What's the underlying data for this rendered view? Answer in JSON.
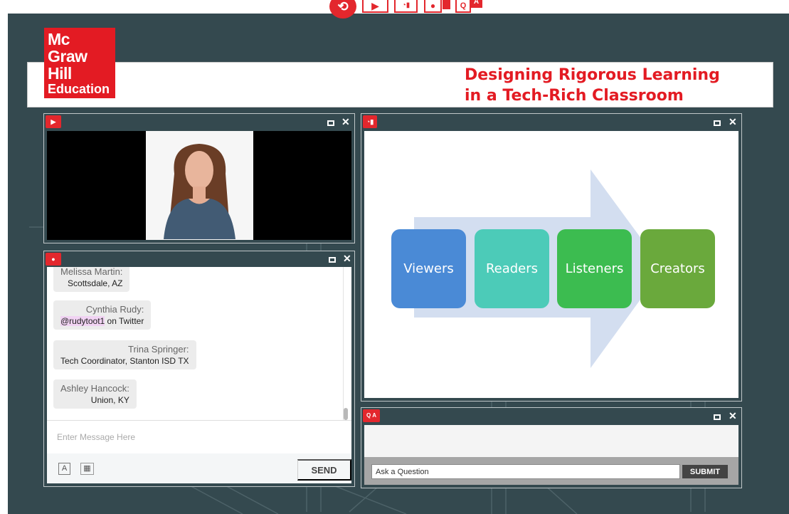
{
  "toolbar": {
    "buttons": [
      {
        "name": "refresh",
        "icon": "refresh-icon",
        "glyph": "⟲"
      },
      {
        "name": "video",
        "icon": "play-icon",
        "glyph": "▶"
      },
      {
        "name": "slides",
        "icon": "slides-chart-icon",
        "glyph": "◔▮"
      },
      {
        "name": "people",
        "icon": "user-chat-icon",
        "glyph": "●"
      },
      {
        "name": "qa",
        "icon": "qa-icon",
        "q": "Q",
        "a": "A"
      }
    ]
  },
  "header": {
    "logo_lines": [
      "Mc",
      "Graw",
      "Hill",
      "Education"
    ],
    "title_line1": "Designing Rigorous Learning",
    "title_line2": "in a Tech-Rich Classroom"
  },
  "video_panel": {
    "badge": "▶",
    "badge_icon": "play-icon"
  },
  "chat_panel": {
    "badge": "●",
    "badge_icon": "user-icon",
    "messages": [
      {
        "name": "Melissa Martin:",
        "text": "Scottsdale, AZ"
      },
      {
        "name": "Cynthia Rudy:",
        "handle": "@rudytoot1",
        "text": " on Twitter"
      },
      {
        "name": "Trina Springer:",
        "text": "Tech Coordinator, Stanton ISD TX"
      },
      {
        "name": "Ashley Hancock:",
        "text": "Union, KY"
      }
    ],
    "input_placeholder": "Enter Message Here",
    "font_icon_glyph": "A",
    "emoji_icon_glyph": "▦",
    "send_label": "SEND"
  },
  "slide_panel": {
    "badge": "◔▮",
    "badge_icon": "slides-chart-icon",
    "steps": [
      "Viewers",
      "Readers",
      "Listeners",
      "Creators"
    ],
    "step_colors": [
      "#4a8ad6",
      "#4ccbb8",
      "#3cbc50",
      "#6aa93c"
    ],
    "arrow_color": "#d3def0"
  },
  "qa_panel": {
    "badge_q": "Q",
    "badge_a": "A",
    "badge_icon": "qa-icon",
    "input_placeholder": "Ask a Question",
    "submit_label": "SUBMIT"
  },
  "panel_controls": {
    "maximize": "maximize-icon",
    "close_glyph": "✕"
  },
  "colors": {
    "brand_red": "#e31b23",
    "board": "#34494f"
  }
}
